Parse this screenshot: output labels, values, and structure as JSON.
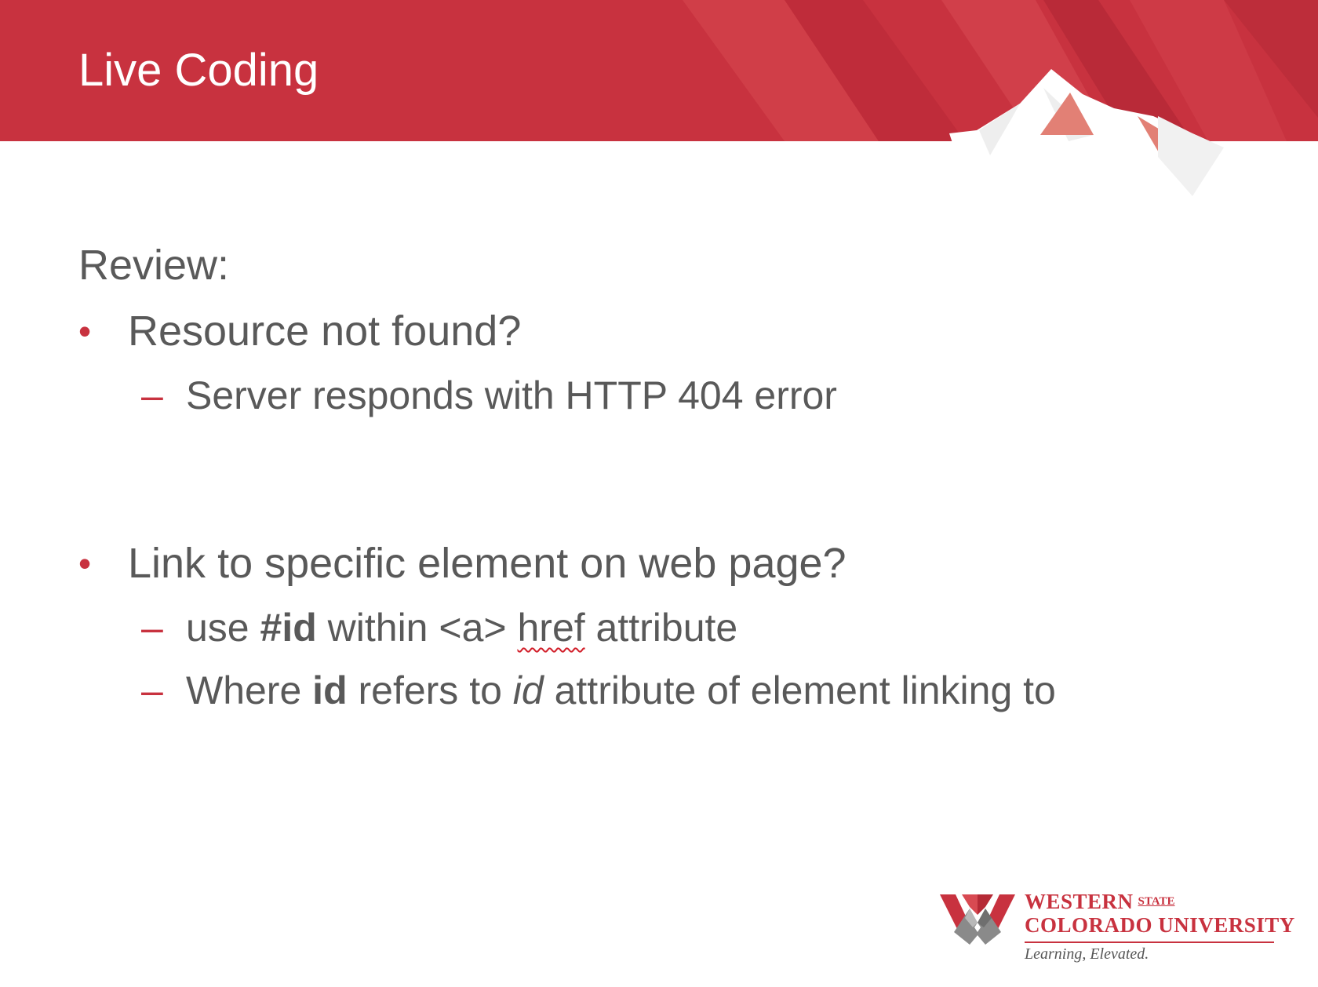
{
  "slide": {
    "title": "Live Coding",
    "review_label": "Review:",
    "bullets": [
      {
        "marker": "•",
        "text": "Resource not found?",
        "sub": [
          {
            "marker": "–",
            "text": "Server responds with HTTP 404 error"
          }
        ]
      },
      {
        "marker": "•",
        "text": "Link to specific element on web page?",
        "sub": [
          {
            "marker": "–",
            "parts": [
              "use ",
              "#id",
              " within <a> ",
              "href",
              " attribute"
            ]
          },
          {
            "marker": "–",
            "parts": [
              "Where ",
              "id",
              " refers to ",
              "id",
              " attribute of element linking to"
            ]
          }
        ]
      }
    ]
  },
  "logo": {
    "line1": "WESTERN",
    "state": "STATE",
    "line2": "COLORADO UNIVERSITY",
    "tagline": "Learning, Elevated."
  },
  "colors": {
    "brand_red": "#c8323f",
    "text_gray": "#595959",
    "white": "#ffffff"
  }
}
